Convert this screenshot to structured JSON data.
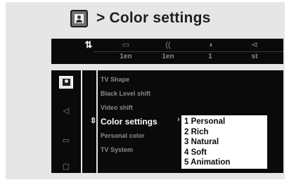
{
  "heading": {
    "title": "> Color settings",
    "icon": "picture-settings-icon"
  },
  "tabs": [
    {
      "icon": "⇅",
      "icon_name": "settings-icon",
      "value": "",
      "active": true
    },
    {
      "icon": "▭",
      "icon_name": "subtitle-icon",
      "value": "1en"
    },
    {
      "icon": "((",
      "icon_name": "audio-icon",
      "value": "1en"
    },
    {
      "icon": "◑",
      "icon_name": "angle-icon",
      "value": "1"
    },
    {
      "icon": "⊲",
      "icon_name": "speaker-icon",
      "value": "st"
    }
  ],
  "side_icons": [
    {
      "name": "picture-icon",
      "glyph": ""
    },
    {
      "name": "sound-icon",
      "glyph": "◁"
    },
    {
      "name": "language-icon",
      "glyph": "▭"
    },
    {
      "name": "features-icon",
      "glyph": "▢"
    }
  ],
  "menu": {
    "items": [
      "TV Shape",
      "Black Level shift",
      "Video shift",
      "Color settings",
      "Personal color",
      "TV System"
    ],
    "selected_index": 3
  },
  "options": [
    "1 Personal",
    "2 Rich",
    "3 Natural",
    "4 Soft",
    "5 Animation"
  ],
  "colors": {
    "background": "#e6e6e6",
    "panel": "#0a0a0a",
    "text_dim": "#8a8a8a",
    "text_active": "#ffffff"
  }
}
